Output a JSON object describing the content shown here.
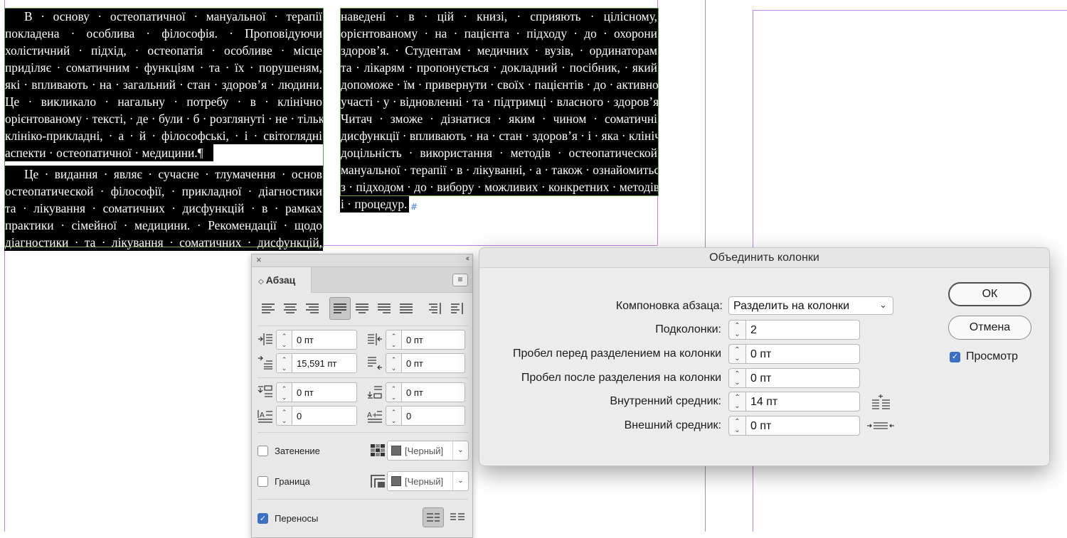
{
  "document": {
    "left_column_lines": [
      "В · основу · остеопатичної · мануальної · терапії",
      "покладена · особлива · філософія. · Проповідуючи",
      "холістичний · підхід, · остеопатія · особливе · місце",
      "приділяє · соматичним · функціям · та · їх · порушеням,",
      "які · впливають · на · загальний · стан · здоров’я · людини.",
      "Це · викликало · нагальну · потребу · в · клінічно",
      "орієнтованому · тексті, · де · були · б · розглянуті · не · тільки",
      "клініко-прикладні, · а · й · філософські, · і · світоглядні",
      "аспекти · остеопатичної · медицини.¶",
      "Це · видання · являє · сучасне · тлумачення · основ",
      "остеопатической · філософії, · прикладної · діагностики",
      "та · лікування · соматичних · дисфункцій · в · рамках",
      "практики · сімейної · медицини. · Рекомендації · щодо",
      "діагностики · та · лікування · соматичних · дисфункцій,"
    ],
    "right_column_lines": [
      "наведені · в · цій · книзі, · сприяють · цілісному,",
      "орієнтованому · на · пацієнта · підходу · до · охорони",
      "здоров’я. · Студентам · медичних · вузів, · ординаторам",
      "та · лікарям · пропонується · докладний · посібник, · який",
      "допоможе · їм · привернути · своїх · пацієнтів · до · активної",
      "участі · у · відновленні · та · підтримці · власного · здоров’я.",
      "Читач · зможе · дізнатися · яким · чином · соматичні",
      "дисфункції · впливають · на · стан · здоров’я · і · яка · клінічна",
      "доцільність · використання · методів · остеопатической",
      "мануальної · терапії · в · лікуванні, · а · також · ознайомиться",
      "з · підходом · до · вибору · можливих · конкретних · методів",
      "і · процедур."
    ],
    "end_mark": "#"
  },
  "paragraph_panel": {
    "close_glyph": "×",
    "collapse_glyph": "‹‹",
    "tab_label": "Абзац",
    "tab_arrow": "◇",
    "menu_glyph": "≡",
    "left_indent": "0 пт",
    "right_indent": "0 пт",
    "first_line_indent": "15,591 пт",
    "last_line_indent": "0 пт",
    "space_before": "0 пт",
    "space_after": "0 пт",
    "drop_cap_lines": "0",
    "drop_cap_chars": "0",
    "shading_label": "Затенение",
    "shading_color": "[Черный]",
    "border_label": "Граница",
    "border_color": "[Черный]",
    "hyphenate_label": "Переносы",
    "hyphenate_checked": true
  },
  "dialog": {
    "title": "Объединить колонки",
    "layout_label": "Компоновка абзаца:",
    "layout_value": "Разделить на колонки",
    "subcolumns_label": "Подколонки:",
    "subcolumns_value": "2",
    "space_before_label": "Пробел перед разделением на колонки",
    "space_before_value": "0 пт",
    "space_after_label": "Пробел после разделения на колонки",
    "space_after_value": "0 пт",
    "inside_gutter_label": "Внутренний средник:",
    "inside_gutter_value": "14 пт",
    "outside_gutter_label": "Внешний средник:",
    "outside_gutter_value": "0 пт",
    "ok_label": "ОК",
    "cancel_label": "Отмена",
    "preview_label": "Просмотр",
    "preview_checked": true
  },
  "colors": {
    "accent": "#3d6fc4",
    "guide": "#c27ee0",
    "text_highlight": "#000000"
  }
}
